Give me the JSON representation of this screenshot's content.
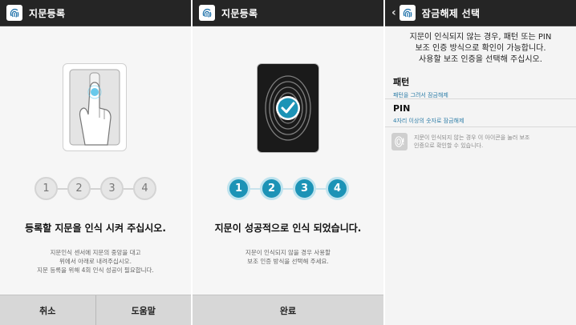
{
  "screen1": {
    "title": "지문등록",
    "steps": [
      "1",
      "2",
      "3",
      "4"
    ],
    "headline": "등록할 지문을 인식 시켜 주십시오.",
    "subtext": [
      "지문인식 센서에 지문의 중앙을 대고",
      "위에서 아래로 내려주십시오.",
      "지문 등록을 위해 4회 인식 성공이 필요합니다."
    ],
    "cancel_label": "취소",
    "help_label": "도움말"
  },
  "screen2": {
    "title": "지문등록",
    "steps": [
      "1",
      "2",
      "3",
      "4"
    ],
    "headline": "지문이 성공적으로 인식 되었습니다.",
    "subtext": [
      "지문이 인식되지 않을 경우 사용할",
      "보조 인증 방식을 선택해 주세요."
    ],
    "done_label": "완료"
  },
  "screen3": {
    "title": "잠금해제 선택",
    "description": [
      "지문이 인식되지 않는 경우, 패턴 또는 PIN",
      "보조 인증 방식으로 확인이 가능합니다.",
      "사용할 보조 인증을 선택해 주십시오."
    ],
    "options": [
      {
        "title": "패턴",
        "subtitle": "패턴을 그려서 잠금해제"
      },
      {
        "title": "PIN",
        "subtitle": "4자리 이상의 숫자로 잠금해제"
      }
    ],
    "note": [
      "지문이 인식되지 않는 경우 이 아이콘을 눌러 보조",
      "인증으로 확인할 수 있습니다."
    ]
  },
  "colors": {
    "appbar": "#252525",
    "accent": "#1c93b6",
    "link": "#2f7ea8",
    "bottom_bar": "#d7d7d7"
  }
}
